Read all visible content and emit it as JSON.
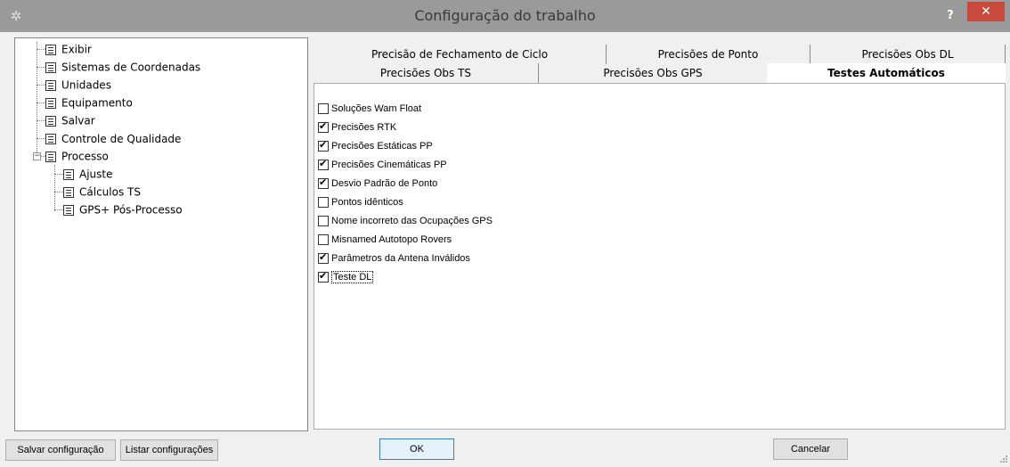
{
  "window": {
    "title": "Configuração do trabalho",
    "help_label": "?",
    "close_label": "✕",
    "app_icon": "gear-icon"
  },
  "tree": {
    "items": [
      {
        "label": "Exibir"
      },
      {
        "label": "Sistemas de Coordenadas"
      },
      {
        "label": "Unidades"
      },
      {
        "label": "Equipamento"
      },
      {
        "label": "Salvar"
      },
      {
        "label": "Controle de Qualidade",
        "selected": true
      },
      {
        "label": "Processo",
        "expanded": true
      },
      {
        "label": "Ajuste"
      },
      {
        "label": "Cálculos TS"
      },
      {
        "label": "GPS+ Pós-Processo"
      }
    ],
    "expander_label": "−"
  },
  "tabs": {
    "row1": [
      "Precisão de Fechamento de Ciclo",
      "Precisões de Ponto",
      "Precisões Obs DL"
    ],
    "row2": [
      "Precisões Obs TS",
      "Precisões Obs GPS",
      "Testes Automáticos"
    ],
    "active": "Testes Automáticos"
  },
  "checks": [
    {
      "label": "Soluções Wam Float",
      "checked": false
    },
    {
      "label": "Precisões RTK",
      "checked": true
    },
    {
      "label": "Precisões Estáticas PP",
      "checked": true
    },
    {
      "label": "Precisões Cinemáticas PP",
      "checked": true
    },
    {
      "label": "Desvio Padrão de Ponto",
      "checked": true
    },
    {
      "label": "Pontos idênticos",
      "checked": false
    },
    {
      "label": "Nome incorreto das Ocupações GPS",
      "checked": false
    },
    {
      "label": "Misnamed Autotopo Rovers",
      "checked": false
    },
    {
      "label": "Parâmetros da Antena Inválidos",
      "checked": true
    },
    {
      "label": "Teste DL",
      "checked": true,
      "focused": true
    }
  ],
  "buttons": {
    "save_config": "Salvar configuração",
    "list_configs": "Listar configurações",
    "ok": "OK",
    "cancel": "Cancelar"
  }
}
